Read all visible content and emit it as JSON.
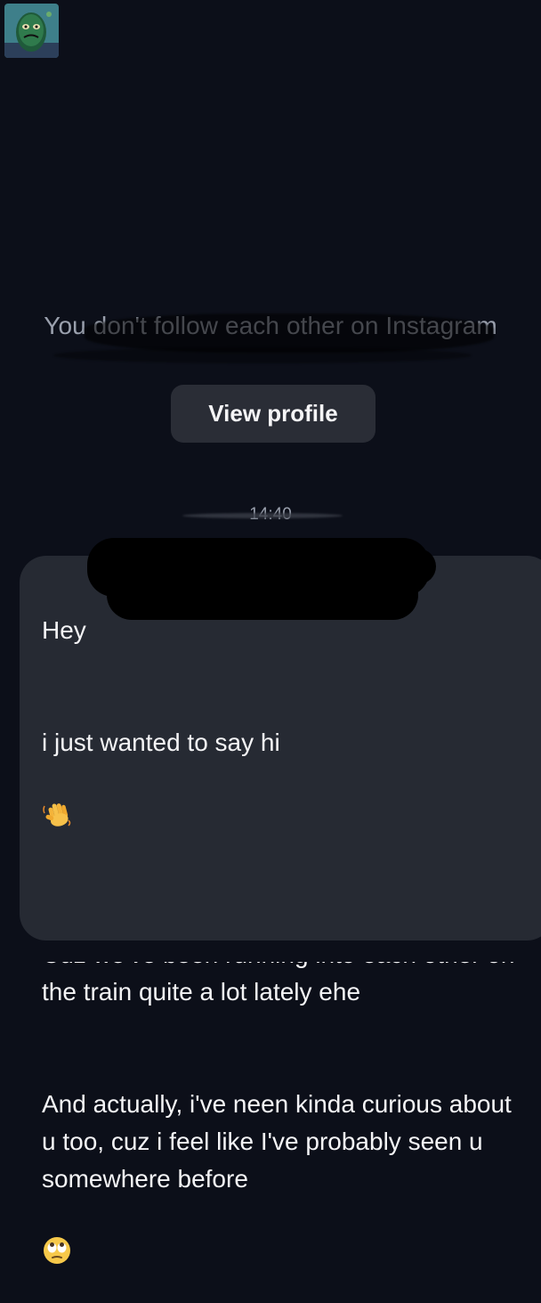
{
  "header": {
    "avatar_icon": "pickle-cartoon-avatar"
  },
  "notice": {
    "follow_text": "You don't follow each other on Instagram"
  },
  "actions": {
    "view_profile_label": "View profile"
  },
  "thread": {
    "timestamp": "14:40",
    "messages": [
      {
        "sender": "other",
        "line_1": "Hey",
        "line_2": "i just wanted to say hi",
        "line_2_emoji": "waving-hand-emoji",
        "line_3": "Cuz we've been running into each other on the train quite a lot lately ehe",
        "line_4": "And actually, i've neen kinda curious about u too, cuz i feel like I've probably seen u somewhere before",
        "line_4_emoji": "eye-roll-emoji"
      }
    ]
  },
  "colors": {
    "background": "#0c0f19",
    "bubble": "#262a33",
    "button": "#2a2d36",
    "muted_text": "#9aa0ad"
  }
}
